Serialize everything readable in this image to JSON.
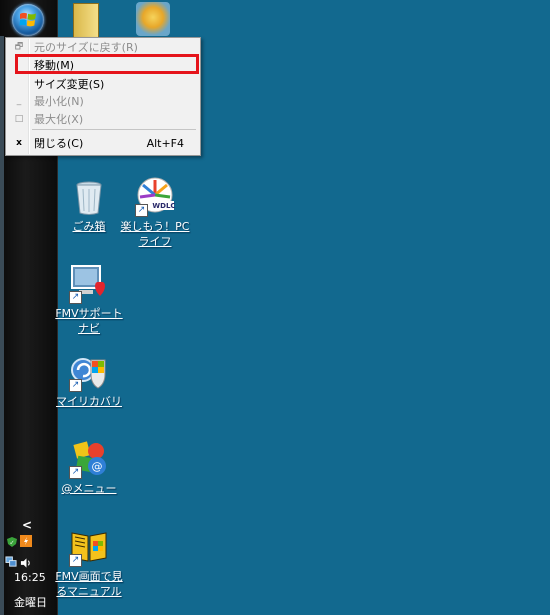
{
  "taskbar": {
    "clock_time": "16:25",
    "clock_day": "金曜日",
    "tray_expand": "<",
    "tray_icons": [
      "network-icon",
      "volume-icon",
      "update-icon",
      "shield-icon"
    ]
  },
  "system_menu": {
    "items": [
      {
        "label": "元のサイズに戻す(R)",
        "icon": "restore-icon",
        "icon_glyph": "🗗",
        "enabled": false,
        "shortcut": ""
      },
      {
        "label": "移動(M)",
        "icon": "",
        "icon_glyph": "",
        "enabled": true,
        "shortcut": "",
        "highlighted": true
      },
      {
        "label": "サイズ変更(S)",
        "icon": "",
        "icon_glyph": "",
        "enabled": true,
        "shortcut": ""
      },
      {
        "label": "最小化(N)",
        "icon": "minimize-icon",
        "icon_glyph": "_",
        "enabled": false,
        "shortcut": ""
      },
      {
        "label": "最大化(X)",
        "icon": "maximize-icon",
        "icon_glyph": "□",
        "enabled": false,
        "shortcut": ""
      },
      {
        "label": "閉じる(C)",
        "icon": "close-icon",
        "icon_glyph": "x",
        "enabled": true,
        "shortcut": "Alt+F4"
      }
    ],
    "highlight_color": "#e5141b"
  },
  "desktop_icons": [
    {
      "label": "ごみ箱",
      "icon": "recycle-bin-icon"
    },
    {
      "label": "楽しもう！PCライフ",
      "icon": "wdlc-icon"
    },
    {
      "label": "FMVサポートナビ",
      "icon": "support-navi-icon"
    },
    {
      "label": "マイリカバリ",
      "icon": "my-recovery-icon"
    },
    {
      "label": "@メニュー",
      "icon": "at-menu-icon"
    },
    {
      "label": "FMV画面で見るマニュアル",
      "icon": "manual-icon"
    }
  ],
  "colors": {
    "desktop_bg": "#12698f",
    "taskbar_bg": "#111111"
  }
}
